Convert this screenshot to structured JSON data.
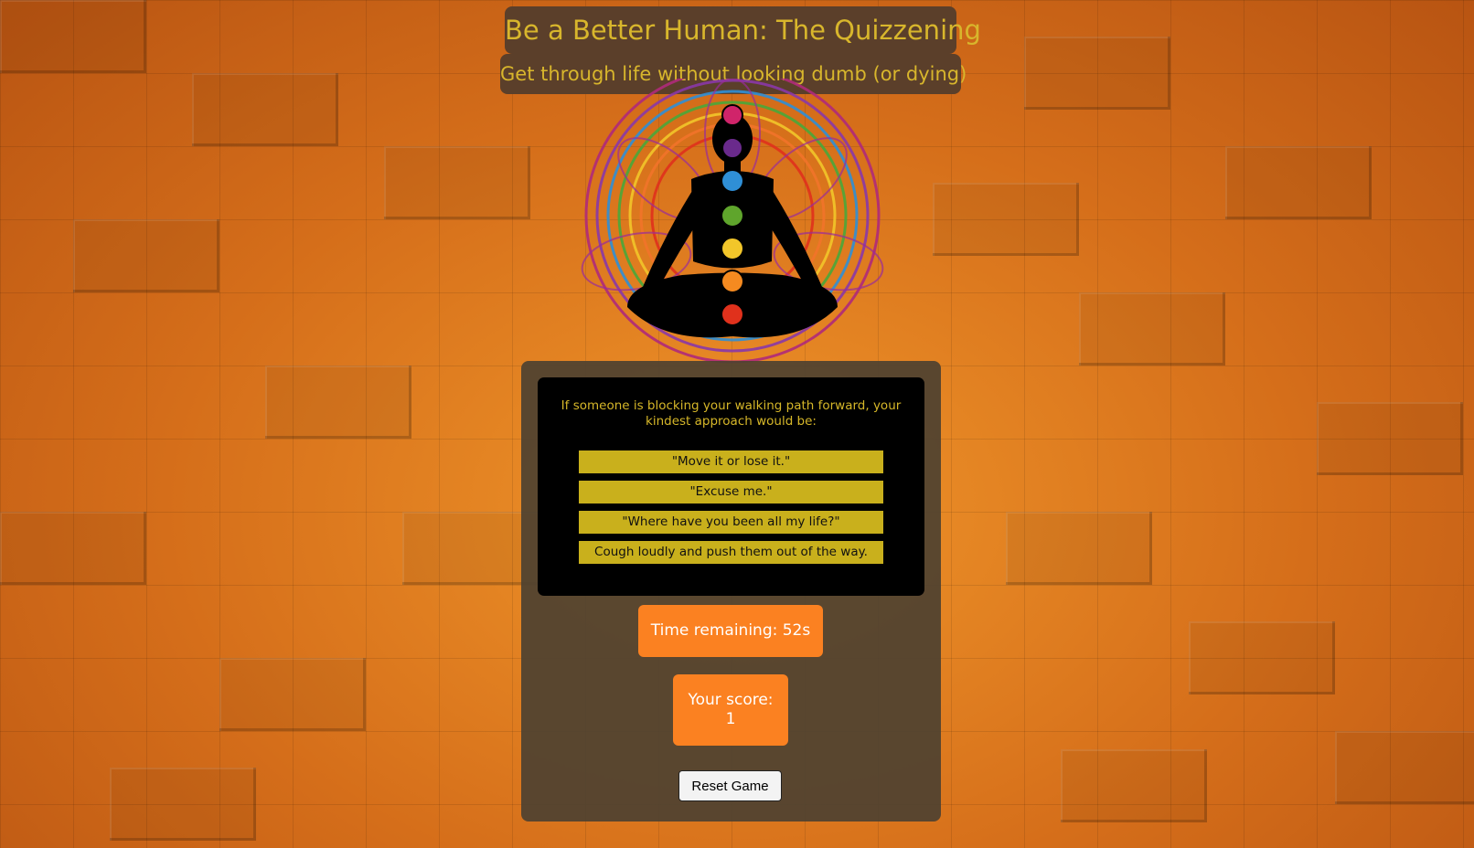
{
  "header": {
    "title": "Be a Better Human: The Quizzening",
    "subtitle": "Get through life without looking dumb (or dying)"
  },
  "hero": {
    "icon": "meditating-figure-chakra-mandala-icon",
    "chakra_colors": [
      "#d0246a",
      "#6a2a8c",
      "#2f8fd6",
      "#5fa52c",
      "#f2c62a",
      "#f58a20",
      "#e0311c"
    ]
  },
  "quiz": {
    "question": "If someone is blocking your walking path forward, your kindest approach would be:",
    "answers": [
      "\"Move it or lose it.\"",
      "\"Excuse me.\"",
      "\"Where have you been all my life?\"",
      "Cough loudly and push them out of the way."
    ]
  },
  "status": {
    "time_remaining": "Time remaining: 52s",
    "score_label": "Your score:",
    "score_value": "1"
  },
  "controls": {
    "reset_label": "Reset Game"
  },
  "colors": {
    "accent_orange": "#fb8121",
    "gold_text": "#d8b62c",
    "answer_bg": "#c9b01c",
    "panel_bg": "#4f4230"
  }
}
